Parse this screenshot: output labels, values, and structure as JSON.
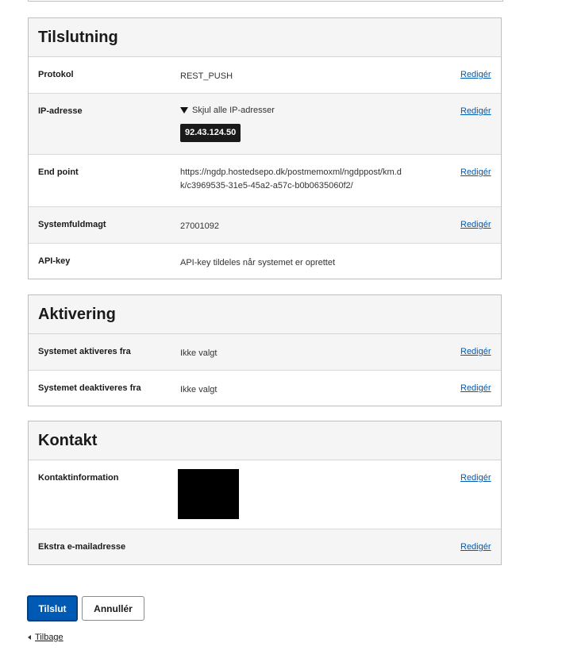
{
  "connection": {
    "title": "Tilslutning",
    "rows": [
      {
        "label": "Protokol",
        "value": "REST_PUSH",
        "action": "Redigér"
      },
      {
        "label": "IP-adresse",
        "toggle": "Skjul alle IP-adresser",
        "ip": "92.43.124.50",
        "action": "Redigér"
      },
      {
        "label": "End point",
        "value_line1": "https://ngdp.hostedsepo.dk/postmemoxml/ngdppost/km.d",
        "value_line2": "k/c3969535-31e5-45a2-a57c-b0b0635060f2/",
        "action": "Redigér"
      },
      {
        "label": "Systemfuldmagt",
        "value": "27001092",
        "action": "Redigér"
      },
      {
        "label": "API-key",
        "value": "API-key tildeles når systemet er oprettet"
      }
    ]
  },
  "activation": {
    "title": "Aktivering",
    "rows": [
      {
        "label": "Systemet aktiveres fra",
        "value": "Ikke valgt",
        "action": "Redigér"
      },
      {
        "label": "Systemet deaktiveres fra",
        "value": "Ikke valgt",
        "action": "Redigér"
      }
    ]
  },
  "contact": {
    "title": "Kontakt",
    "rows": [
      {
        "label": "Kontaktinformation",
        "action": "Redigér"
      },
      {
        "label": "Ekstra e-mailadresse",
        "action": "Redigér"
      }
    ]
  },
  "footer": {
    "primary_label": "Tilslut",
    "secondary_label": "Annullér",
    "back_label": "Tilbage"
  },
  "colors": {
    "link": "#0059b3",
    "primary_button": "#0059b3",
    "ip_badge_bg": "#1a1a1a"
  }
}
